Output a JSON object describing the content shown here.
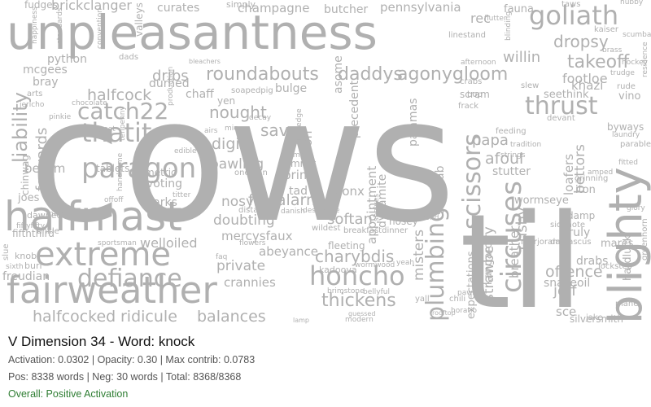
{
  "colors": {
    "word_fill": "#b0b0b0",
    "status_positive": "#2e7d32"
  },
  "header": {
    "title": "V Dimension 34 - Word: knock"
  },
  "stats": {
    "activation_line": "Activation: 0.0302 | Opacity: 0.30 | Max contrib: 0.0783",
    "counts_line": "Pos: 8338 words | Neg: 30 words | Total: 8368/8368",
    "status": "Overall: Positive Activation"
  },
  "wordcloud": {
    "words": [
      "cows",
      "til",
      "unpleasantness",
      "halfmast",
      "fairweather",
      "extreme",
      "blighty",
      "goliath",
      "honcho",
      "paragon",
      "defiance",
      "thatit",
      "catch22",
      "thrust",
      "circuses",
      "plumbing",
      "scissors",
      "charybdis",
      "thickens",
      "halfcocked",
      "ridicule",
      "balances",
      "agonygloom",
      "daddys",
      "roundabouts",
      "dribs",
      "dropsy",
      "takeoff",
      "liability",
      "python",
      "brickclanger",
      "curates",
      "champagne",
      "butcher",
      "pennsylvania",
      "rec",
      "willin",
      "halfcock",
      "nought",
      "sav",
      "digits",
      "bawling",
      "fivealarm",
      "nosy",
      "softan",
      "doubting",
      "private",
      "crannies",
      "welloiled",
      "mercysfaux",
      "abeyance",
      "forwards",
      "afoul",
      "papa",
      "cushy",
      "strawberry",
      "jeff",
      "offence",
      "sce",
      "breather",
      "misters",
      "bronx",
      "union",
      "prima",
      "tad",
      "dammit",
      "sharks",
      "voting",
      "metric",
      "tablets",
      "besom",
      "chinwag",
      "joes",
      "freudian",
      "fifththird",
      "durned",
      "chaff",
      "bulge",
      "asome",
      "scram",
      "khazi",
      "seethink",
      "loafers",
      "bettors",
      "stutter",
      "wormseye",
      "iton",
      "truly",
      "drabs",
      "snakeoil",
      "mares",
      "hardluck",
      "silversmith",
      "bray",
      "mcgees",
      "fudges",
      "footloe",
      "kangaroo",
      "dynamite",
      "shotstab",
      "appointment",
      "expectations",
      "fleeting",
      "kadoova",
      "precedent",
      "pajamas",
      "soapedpig",
      "yen",
      "damp",
      "byways",
      "vino",
      "fauna",
      "taws",
      "valleys",
      "simply",
      "dads",
      "linestand",
      "crabs",
      "slew",
      "rude",
      "parables",
      "greenhorn",
      "lockstep",
      "jake",
      "mane",
      "sidenote",
      "marjoram",
      "damascus",
      "knob",
      "slue",
      "fiftyfifty",
      "dawned",
      "tinkle",
      "burl",
      "sixth",
      "nape",
      "oneman",
      "drama",
      "distant",
      "danish",
      "desperate",
      "wildest",
      "nosey",
      "shelves",
      "flowers",
      "faq",
      "brimstone",
      "bellyful",
      "yall",
      "chili",
      "modern",
      "wormwood",
      "breakfastdinner",
      "yeah",
      "happiness",
      "titter",
      "offoff",
      "edible",
      "knifeedge",
      "feeding",
      "bop",
      "frack",
      "devant",
      "tradition",
      "strings",
      "hubby",
      "fitted",
      "glory",
      "laundry",
      "chocolate",
      "sportsman",
      "afternoon",
      "grinning",
      "amped",
      "horatio",
      "paws",
      "airs",
      "mic",
      "decay",
      "production",
      "arts",
      "jericho",
      "greet",
      "tenpenny",
      "handsome",
      "pinkie",
      "diamond",
      "residence",
      "scumbag",
      "blinding",
      "flutter",
      "kaiser",
      "brass",
      "hockey",
      "trudge",
      "guessed",
      "lamp",
      "bleachers",
      "convention",
      "standards",
      "rooftop"
    ]
  },
  "axes": {}
}
